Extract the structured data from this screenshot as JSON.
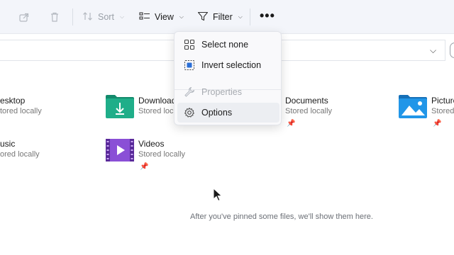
{
  "toolbar": {
    "sort_label": "Sort",
    "view_label": "View",
    "filter_label": "Filter",
    "more_label": "•••"
  },
  "menu": {
    "items": [
      {
        "label": "Select none",
        "icon": "select-none-icon",
        "enabled": true
      },
      {
        "label": "Invert selection",
        "icon": "invert-selection-icon",
        "enabled": true
      },
      {
        "label": "Properties",
        "icon": "wrench-icon",
        "enabled": false
      },
      {
        "label": "Options",
        "icon": "gear-icon",
        "enabled": true
      }
    ]
  },
  "tiles": [
    {
      "name": "esktop",
      "sub": "tored locally"
    },
    {
      "name": "Download",
      "sub": "Stored loc"
    },
    {
      "name": "Documents",
      "sub": "Stored locally"
    },
    {
      "name": "Picture",
      "sub": "Stored"
    },
    {
      "name": "usic",
      "sub": "ored locally"
    },
    {
      "name": "Videos",
      "sub": "Stored locally"
    }
  ],
  "empty_message": "After you've pinned some files, we'll show them here.",
  "colors": {
    "toolbar_bg": "#f3f5fa",
    "menu_bg": "#f9f9fb",
    "downloads_folder": "#1a9c7c",
    "pictures_folder": "#1e88d6",
    "videos_folder": "#7a3fc4"
  }
}
